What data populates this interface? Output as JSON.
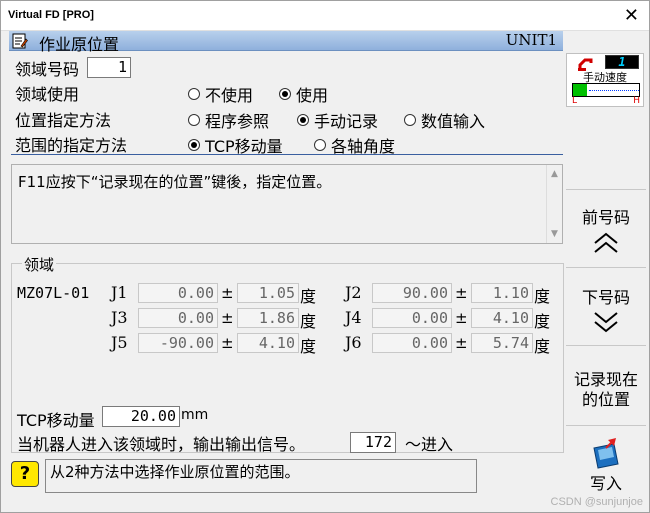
{
  "window": {
    "title": "Virtual FD [PRO]",
    "close": "✕"
  },
  "header": {
    "title": "作业原位置",
    "unit": "UNIT1"
  },
  "form": {
    "area_no_label": "领域号码",
    "area_no_value": "1",
    "area_use_label": "领域使用",
    "area_use_options": [
      "不使用",
      "使用"
    ],
    "area_use_selected": 1,
    "pos_method_label": "位置指定方法",
    "pos_method_options": [
      "程序参照",
      "手动记录",
      "数值输入"
    ],
    "pos_method_selected": 1,
    "range_method_label": "范围的指定方法",
    "range_method_options": [
      "TCP移动量",
      "各轴角度"
    ],
    "range_method_selected": 0
  },
  "message": "F11应按下“记录现在的位置”键後，指定位置。",
  "area": {
    "group_label": "领域",
    "model": "MZ07L-01",
    "pm": "±",
    "deg": "度",
    "joints": [
      {
        "name": "J1",
        "value": "0.00",
        "tol": "1.05"
      },
      {
        "name": "J2",
        "value": "90.00",
        "tol": "1.10"
      },
      {
        "name": "J3",
        "value": "0.00",
        "tol": "1.86"
      },
      {
        "name": "J4",
        "value": "0.00",
        "tol": "4.10"
      },
      {
        "name": "J5",
        "value": "-90.00",
        "tol": "4.10"
      },
      {
        "name": "J6",
        "value": "0.00",
        "tol": "5.74"
      }
    ],
    "tcp_label": "TCP移动量",
    "tcp_value": "20.00",
    "tcp_unit": "mm",
    "signal_text": "当机器人进入该领域时，输出输出信号。",
    "signal_value": "172",
    "signal_suffix": "～进入"
  },
  "speed": {
    "label": "手动速度",
    "value": "1",
    "low": "L",
    "high": "H"
  },
  "side_buttons": {
    "prev": "前号码",
    "next": "下号码",
    "record_line1": "记录现在",
    "record_line2": "的位置",
    "write": "写入"
  },
  "help": {
    "icon": "?",
    "text": "从2种方法中选择作业原位置的范围。"
  },
  "watermark": "CSDN @sunjunjoe",
  "colors": {
    "header": "#a8c4e8",
    "selected_radio": "#000000",
    "speed_bar": "#00c000"
  }
}
